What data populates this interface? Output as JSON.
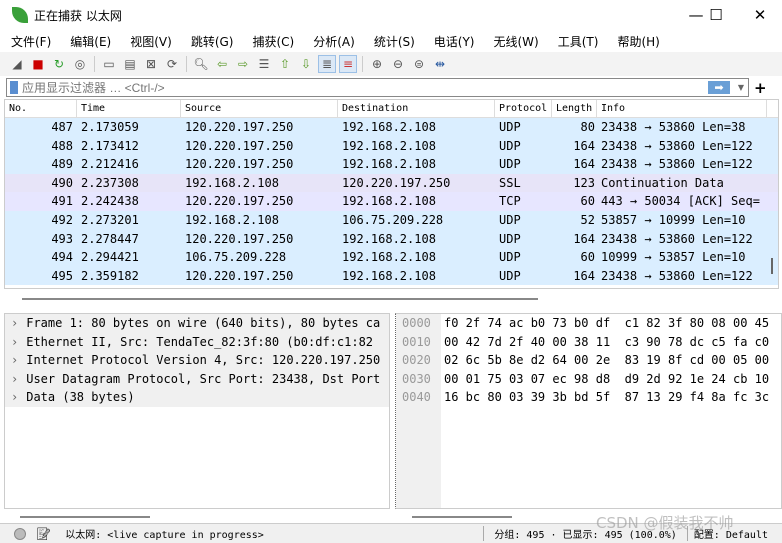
{
  "window": {
    "title": "正在捕获 以太网",
    "minimize": "—",
    "maximize": "☐",
    "close": "✕"
  },
  "menu": [
    "文件(F)",
    "编辑(E)",
    "视图(V)",
    "跳转(G)",
    "捕获(C)",
    "分析(A)",
    "统计(S)",
    "电话(Y)",
    "无线(W)",
    "工具(T)",
    "帮助(H)"
  ],
  "toolbar": [
    {
      "name": "shark-fin-start-icon",
      "g": "◢"
    },
    {
      "name": "stop-capture-icon",
      "g": "■",
      "color": "#cc0000"
    },
    {
      "name": "restart-capture-icon",
      "g": "↻",
      "color": "#2a9d2a"
    },
    {
      "name": "capture-options-icon",
      "g": "◎"
    },
    {
      "sep": true
    },
    {
      "name": "open-file-icon",
      "g": "▭"
    },
    {
      "name": "save-file-icon",
      "g": "▤"
    },
    {
      "name": "close-file-icon",
      "g": "⊠"
    },
    {
      "name": "reload-file-icon",
      "g": "⟳"
    },
    {
      "sep": true
    },
    {
      "name": "find-packet-icon",
      "g": "🔍︎"
    },
    {
      "name": "go-back-icon",
      "g": "⇦",
      "color": "#5a9a2a"
    },
    {
      "name": "go-forward-icon",
      "g": "⇨",
      "color": "#5a9a2a"
    },
    {
      "name": "go-to-packet-icon",
      "g": "☰"
    },
    {
      "name": "go-first-icon",
      "g": "⇧",
      "color": "#5a9a2a"
    },
    {
      "name": "go-last-icon",
      "g": "⇩",
      "color": "#5a9a2a"
    },
    {
      "name": "auto-scroll-icon",
      "g": "≣",
      "active": true
    },
    {
      "name": "colorize-icon",
      "g": "≡",
      "color": "#c33",
      "active": true
    },
    {
      "sep": true
    },
    {
      "name": "zoom-in-icon",
      "g": "⊕"
    },
    {
      "name": "zoom-out-icon",
      "g": "⊖"
    },
    {
      "name": "zoom-reset-icon",
      "g": "⊜"
    },
    {
      "name": "resize-columns-icon",
      "g": "⇹",
      "color": "#2a5aa0"
    }
  ],
  "filter": {
    "placeholder": "应用显示过滤器 … <Ctrl-/>",
    "apply": "➡",
    "add": "+"
  },
  "columns": [
    "No.",
    "Time",
    "Source",
    "Destination",
    "Protocol",
    "Length",
    "Info"
  ],
  "colors": {
    "udp": "#daeeff",
    "ssl": "#e7e4f8",
    "tcp": "#e7e6ff"
  },
  "packets": [
    [
      "487",
      "2.173059",
      "120.220.197.250",
      "192.168.2.108",
      "UDP",
      "80",
      "23438 → 53860 Len=38",
      "udp"
    ],
    [
      "488",
      "2.173412",
      "120.220.197.250",
      "192.168.2.108",
      "UDP",
      "164",
      "23438 → 53860 Len=122",
      "udp"
    ],
    [
      "489",
      "2.212416",
      "120.220.197.250",
      "192.168.2.108",
      "UDP",
      "164",
      "23438 → 53860 Len=122",
      "udp"
    ],
    [
      "490",
      "2.237308",
      "192.168.2.108",
      "120.220.197.250",
      "SSL",
      "123",
      "Continuation Data",
      "ssl"
    ],
    [
      "491",
      "2.242438",
      "120.220.197.250",
      "192.168.2.108",
      "TCP",
      "60",
      "443 → 50034 [ACK] Seq=",
      "tcp"
    ],
    [
      "492",
      "2.273201",
      "192.168.2.108",
      "106.75.209.228",
      "UDP",
      "52",
      "53857 → 10999 Len=10",
      "udp"
    ],
    [
      "493",
      "2.278447",
      "120.220.197.250",
      "192.168.2.108",
      "UDP",
      "164",
      "23438 → 53860 Len=122",
      "udp"
    ],
    [
      "494",
      "2.294421",
      "106.75.209.228",
      "192.168.2.108",
      "UDP",
      "60",
      "10999 → 53857 Len=10",
      "udp"
    ],
    [
      "495",
      "2.359182",
      "120.220.197.250",
      "192.168.2.108",
      "UDP",
      "164",
      "23438 → 53860 Len=122",
      "udp"
    ]
  ],
  "details": [
    "Frame 1: 80 bytes on wire (640 bits), 80 bytes ca",
    "Ethernet II, Src: TendaTec_82:3f:80 (b0:df:c1:82",
    "Internet Protocol Version 4, Src: 120.220.197.250",
    "User Datagram Protocol, Src Port: 23438, Dst Port",
    "Data (38 bytes)"
  ],
  "hex": [
    [
      "0000",
      "f0 2f 74 ac b0 73 b0 df  c1 82 3f 80 08 00 45"
    ],
    [
      "0010",
      "00 42 7d 2f 40 00 38 11  c3 90 78 dc c5 fa c0"
    ],
    [
      "0020",
      "02 6c 5b 8e d2 64 00 2e  83 19 8f cd 00 05 00"
    ],
    [
      "0030",
      "00 01 75 03 07 ec 98 d8  d9 2d 92 1e 24 cb 10"
    ],
    [
      "0040",
      "16 bc 80 03 39 3b bd 5f  87 13 29 f4 8a fc 3c"
    ]
  ],
  "status": {
    "iface": "以太网: <live capture in progress>",
    "packets": "分组: 495 · 已显示: 495 (100.0%)",
    "profile": "配置: Default",
    "watermark": "CSDN @假装我不帅"
  }
}
